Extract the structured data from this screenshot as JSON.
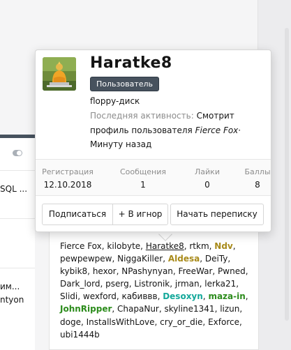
{
  "background": {
    "left_snippets": [
      "SQL ...",
      "им...",
      "ntyon"
    ]
  },
  "online": {
    "users": [
      {
        "name": "Fierce Fox",
        "style": "plain"
      },
      {
        "name": "kilobyte",
        "style": "plain"
      },
      {
        "name": "Haratke8",
        "style": "underline"
      },
      {
        "name": "rtkm",
        "style": "plain"
      },
      {
        "name": "Ndv",
        "style": "gold"
      },
      {
        "name": "pewpewpew",
        "style": "plain"
      },
      {
        "name": "NiggaKiller",
        "style": "plain"
      },
      {
        "name": "Aldesa",
        "style": "gold"
      },
      {
        "name": "DeiTy",
        "style": "plain"
      },
      {
        "name": "kybik8",
        "style": "plain"
      },
      {
        "name": "hexor",
        "style": "plain"
      },
      {
        "name": "NPashynyan",
        "style": "plain"
      },
      {
        "name": "FreeWar",
        "style": "plain"
      },
      {
        "name": "Pwned",
        "style": "plain"
      },
      {
        "name": "Dark_lord",
        "style": "plain"
      },
      {
        "name": "pserg",
        "style": "plain"
      },
      {
        "name": "Listronik",
        "style": "plain"
      },
      {
        "name": "jrman",
        "style": "plain"
      },
      {
        "name": "lerka21",
        "style": "plain"
      },
      {
        "name": "Slidi",
        "style": "plain"
      },
      {
        "name": "wexford",
        "style": "plain"
      },
      {
        "name": "кабиввв",
        "style": "plain"
      },
      {
        "name": "Desoxyn",
        "style": "teal"
      },
      {
        "name": "maza-in",
        "style": "green"
      },
      {
        "name": "JohnRipper",
        "style": "green"
      },
      {
        "name": "ChapaNur",
        "style": "plain"
      },
      {
        "name": "skyline1341",
        "style": "plain"
      },
      {
        "name": "lizun",
        "style": "plain"
      },
      {
        "name": "doge",
        "style": "plain"
      },
      {
        "name": "InstallsWithLove",
        "style": "plain"
      },
      {
        "name": "cry_or_die",
        "style": "plain"
      },
      {
        "name": "Exforce",
        "style": "plain"
      },
      {
        "name": "ubi1444b",
        "style": "plain"
      }
    ]
  },
  "card": {
    "username": "Haratke8",
    "badge": "Пользователь",
    "custom_title": "floppy-диск",
    "activity_label": "Последняя активность:",
    "activity_text": "Смотрит профиль пользователя",
    "activity_link": "Fierce Fox",
    "activity_sep": "·",
    "activity_time": "Минуту назад",
    "stats": {
      "reg_label": "Регистрация",
      "reg_value": "12.10.2018",
      "msg_label": "Сообщения",
      "msg_value": "1",
      "likes_label": "Лайки",
      "likes_value": "0",
      "points_label": "Баллы",
      "points_value": "8"
    },
    "buttons": {
      "follow": "Подписаться",
      "ignore": "+ В игнор",
      "message": "Начать переписку"
    }
  },
  "colors": {
    "badge_bg": "#47525e",
    "gold_user": "#a88a1a",
    "teal_user": "#14a89a",
    "green_user": "#2c8c1c"
  }
}
